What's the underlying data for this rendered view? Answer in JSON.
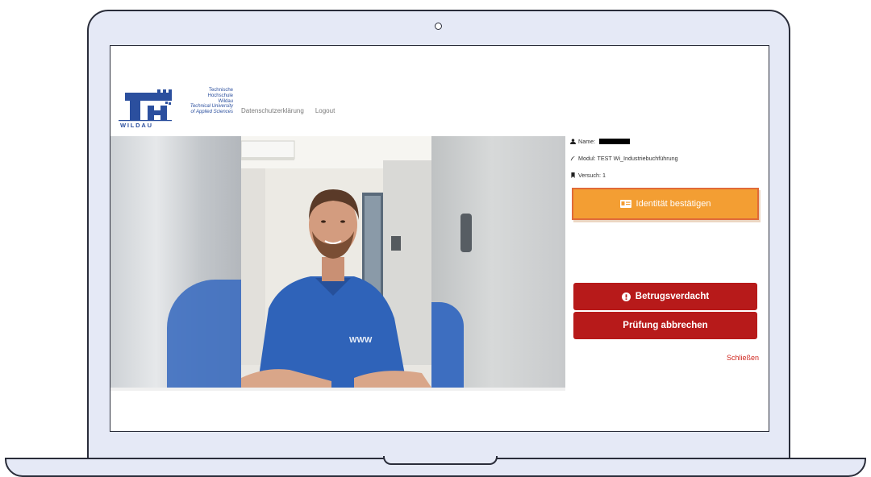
{
  "brand": {
    "logo_lines": [
      "Technische",
      "Hochschule",
      "Wildau",
      "Technical University",
      "of Applied Sciences"
    ],
    "logo_wordmark": "WILDAU",
    "logo_letters": "TH",
    "primary_color": "#2b4f9e"
  },
  "nav": {
    "links": [
      "Datenschutzerklärung",
      "Logout"
    ]
  },
  "video": {
    "description_icon": "webcam-feed",
    "shirt_print": "WWW"
  },
  "panel": {
    "name_label": "Name:",
    "modul": "Modul: TEST Wi_Industriebuchführung",
    "versuch": "Versuch: 1",
    "confirm_label": "Identität bestätigen",
    "fraud_label": "Betrugsverdacht",
    "abort_label": "Prüfung abbrechen",
    "close_label": "Schließen",
    "colors": {
      "confirm": "#f39e33",
      "danger": "#b71a1a",
      "close": "#d0271f"
    },
    "icons": [
      "user-icon",
      "feather-icon",
      "bookmark-icon",
      "id-card-icon",
      "exclamation-circle-icon"
    ]
  }
}
